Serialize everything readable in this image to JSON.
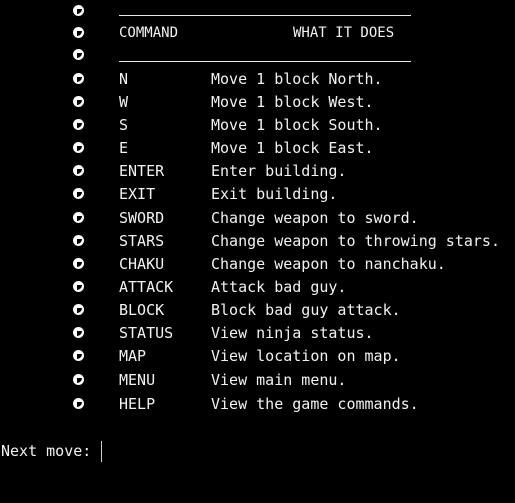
{
  "table": {
    "header_command": "COMMAND",
    "header_description": "WHAT IT DOES",
    "rule": "________________________________",
    "rows": [
      {
        "command": "N",
        "description": "Move 1 block North."
      },
      {
        "command": "W",
        "description": "Move 1 block West."
      },
      {
        "command": "S",
        "description": "Move 1 block South."
      },
      {
        "command": "E",
        "description": "Move 1 block East."
      },
      {
        "command": "ENTER",
        "description": "Enter building."
      },
      {
        "command": "EXIT",
        "description": "Exit building."
      },
      {
        "command": "SWORD",
        "description": "Change weapon to sword."
      },
      {
        "command": "STARS",
        "description": "Change weapon to throwing stars."
      },
      {
        "command": "CHAKU",
        "description": "Change weapon to nanchaku."
      },
      {
        "command": "ATTACK",
        "description": "Attack bad guy."
      },
      {
        "command": "BLOCK",
        "description": "Block bad guy attack."
      },
      {
        "command": "STATUS",
        "description": "View ninja status."
      },
      {
        "command": "MAP",
        "description": "View location on map."
      },
      {
        "command": "MENU",
        "description": "View main menu."
      },
      {
        "command": "HELP",
        "description": "View the game commands."
      }
    ]
  },
  "prompt": {
    "label": "Next move:",
    "value": ""
  },
  "icons": {
    "bullet": "bullet-icon"
  },
  "colors": {
    "background": "#000000",
    "text": "#f2f2f2"
  }
}
